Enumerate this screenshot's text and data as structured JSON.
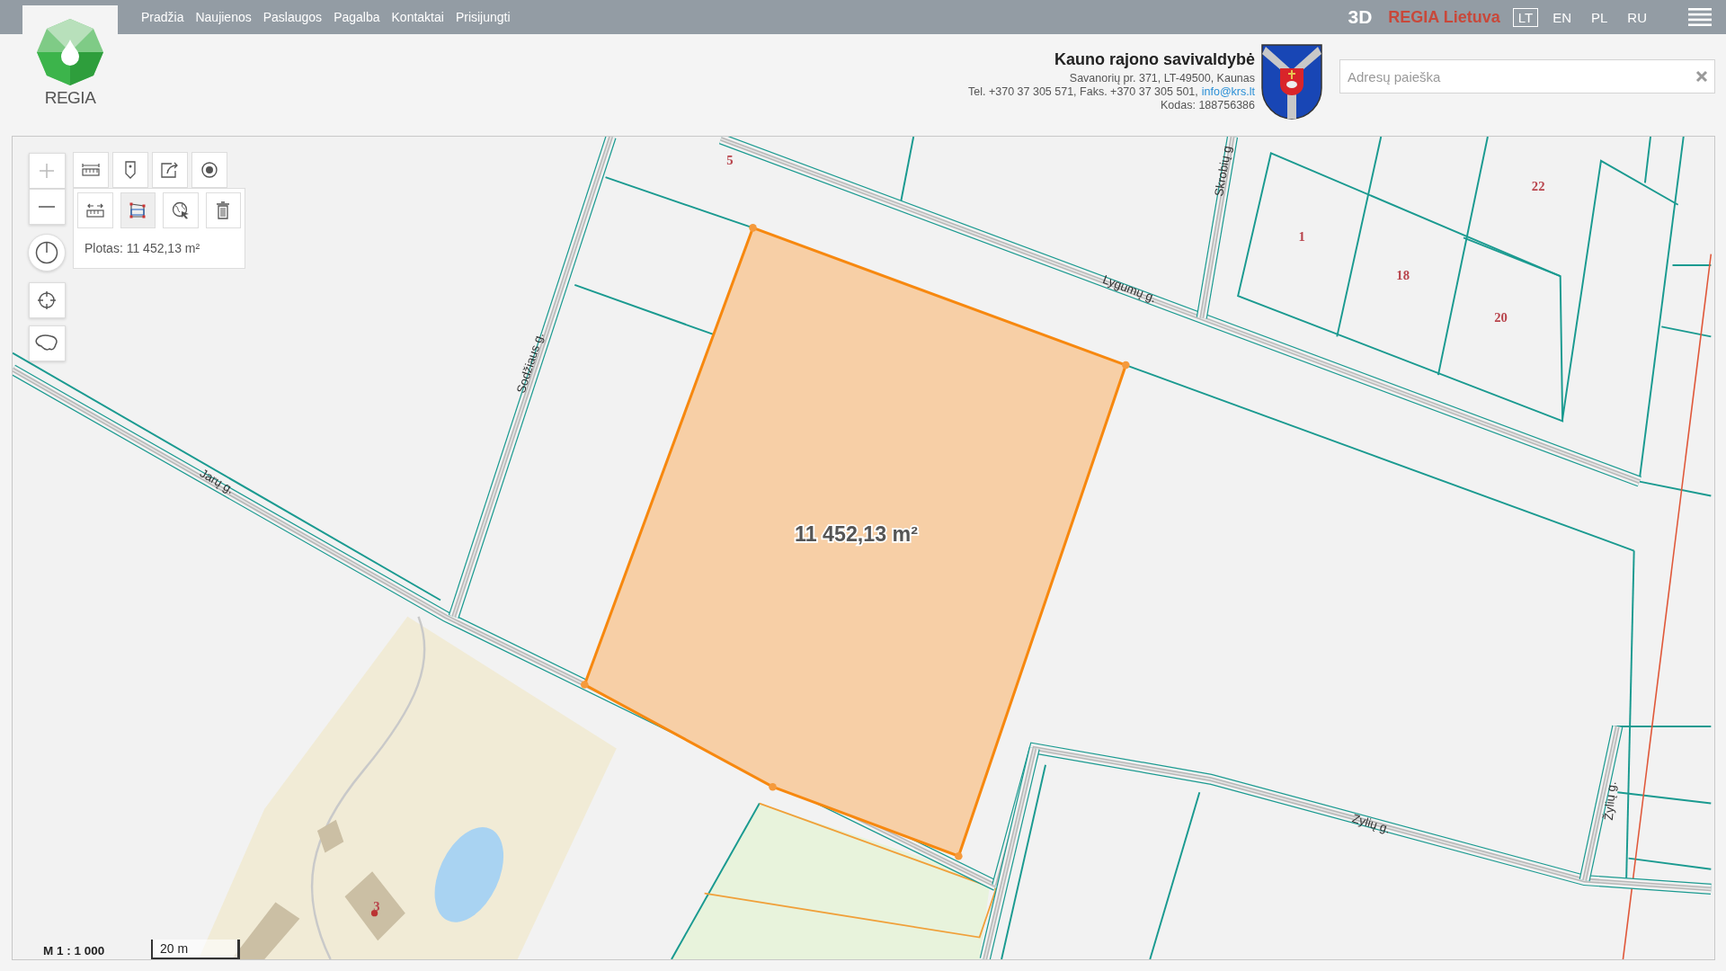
{
  "top_nav": {
    "links": [
      "Pradžia",
      "Naujienos",
      "Paslaugos",
      "Pagalba",
      "Kontaktai",
      "Prisijungti"
    ],
    "mode_3d": "3D",
    "brand": "REGIA Lietuva",
    "languages": [
      {
        "label": "LT",
        "selected": true
      },
      {
        "label": "EN",
        "selected": false
      },
      {
        "label": "PL",
        "selected": false
      },
      {
        "label": "RU",
        "selected": false
      }
    ]
  },
  "logo": {
    "text": "REGIA"
  },
  "municipality": {
    "name": "Kauno rajono savivaldybė",
    "address": "Savanorių pr. 371, LT-49500, Kaunas",
    "contacts": "Tel. +370 37 305 571, Faks. +370 37 305 501,",
    "email": "info@krs.lt",
    "code": "Kodas: 188756386"
  },
  "search": {
    "placeholder": "Adresų paieška"
  },
  "side_controls": [
    {
      "kind": "zoom-in"
    },
    {
      "kind": "zoom-out"
    },
    {
      "kind": "power"
    },
    {
      "kind": "locate"
    },
    {
      "kind": "outline"
    }
  ],
  "tools_row": [
    {
      "kind": "ruler"
    },
    {
      "kind": "pin"
    },
    {
      "kind": "share"
    },
    {
      "kind": "target"
    }
  ],
  "measure_tools": [
    {
      "kind": "distance",
      "selected": false
    },
    {
      "kind": "area",
      "selected": true
    },
    {
      "kind": "globe",
      "selected": false
    },
    {
      "kind": "trash",
      "selected": false
    }
  ],
  "measure_result": "Plotas: 11 452,13 m²",
  "map": {
    "area_label": "11 452,13 m²",
    "parcels": [
      "5",
      "22",
      "1",
      "18",
      "20",
      "3"
    ],
    "streets": [
      "Sodžiaus g.",
      "Jarų g.",
      "Lygumų g.",
      "Skrobių g",
      "Zylių g.",
      "Žylių g."
    ]
  },
  "scale": {
    "ratio": "M 1 : 1 000",
    "bar": "20 m"
  }
}
